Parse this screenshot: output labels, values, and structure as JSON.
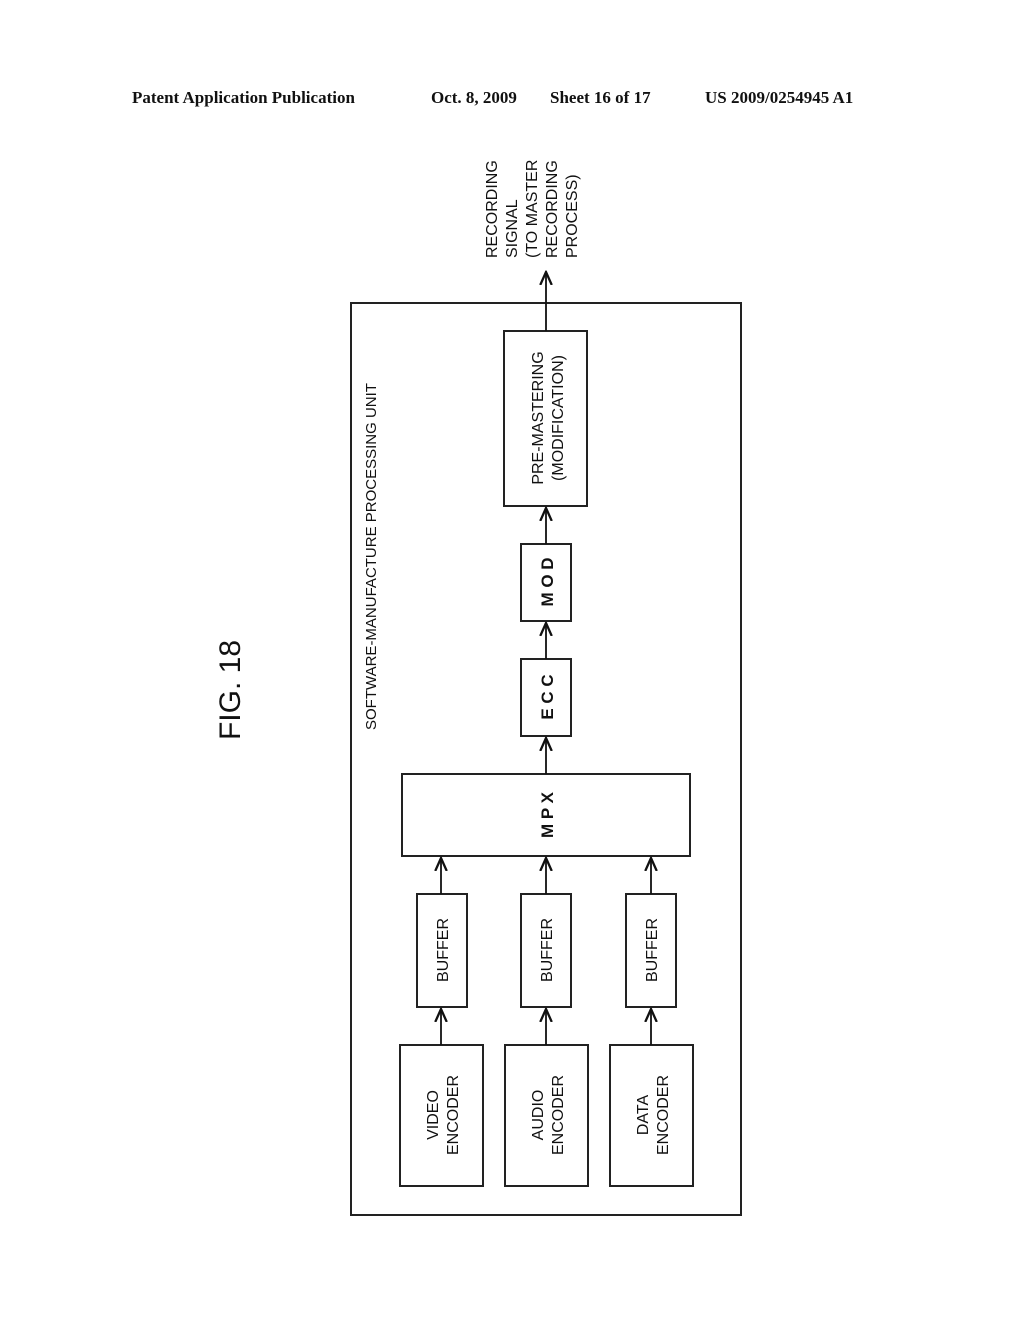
{
  "header": {
    "publication": "Patent Application Publication",
    "date": "Oct. 8, 2009",
    "sheet": "Sheet 16 of 17",
    "number": "US 2009/0254945 A1"
  },
  "figure": {
    "title": "FIG. 18",
    "unit_label": "SOFTWARE-MANUFACTURE PROCESSING UNIT",
    "output_label": [
      "RECORDING",
      "SIGNAL",
      "(TO MASTER",
      "RECORDING",
      "PROCESS)"
    ],
    "blocks": {
      "video_encoder": [
        "VIDEO",
        "ENCODER"
      ],
      "audio_encoder": [
        "AUDIO",
        "ENCODER"
      ],
      "data_encoder": [
        "DATA",
        "ENCODER"
      ],
      "buffer": "BUFFER",
      "mpx": "M P X",
      "ecc": "E C C",
      "mod": "M O D",
      "premastering": [
        "PRE-MASTERING",
        "(MODIFICATION)"
      ]
    }
  }
}
